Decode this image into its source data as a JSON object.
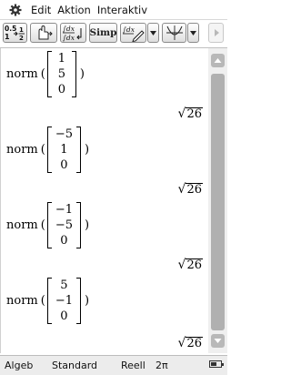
{
  "menubar": {
    "settings_icon": "gear-icon",
    "items": [
      "Edit",
      "Aktion",
      "Interaktiv"
    ]
  },
  "toolbar": {
    "buttons": [
      {
        "icon": "fraction-decimal-toggle-icon",
        "label": "0.5 ↔ 1/2"
      },
      {
        "icon": "drag-hand-icon"
      },
      {
        "icon": "integral-evaluate-icon"
      },
      {
        "label": "Simp"
      },
      {
        "icon": "integral-edit-icon"
      },
      {
        "icon": "dropdown-arrow-icon"
      },
      {
        "icon": "graph-icon"
      },
      {
        "icon": "dropdown-arrow-icon"
      },
      {
        "icon": "toolbar-next-icon"
      }
    ]
  },
  "entries": [
    {
      "function": "norm",
      "open": "(",
      "close": ")",
      "vector": [
        "1",
        "5",
        "0"
      ],
      "result_radicand": "26"
    },
    {
      "function": "norm",
      "open": "(",
      "close": ")",
      "vector": [
        "−5",
        "1",
        "0"
      ],
      "result_radicand": "26"
    },
    {
      "function": "norm",
      "open": "(",
      "close": ")",
      "vector": [
        "−1",
        "−5",
        "0"
      ],
      "result_radicand": "26"
    },
    {
      "function": "norm",
      "open": "(",
      "close": ")",
      "vector": [
        "5",
        "−1",
        "0"
      ],
      "result_radicand": "26"
    }
  ],
  "statusbar": {
    "mode": "Algeb",
    "format": "Standard",
    "number_domain": "Reell",
    "angle": "2π",
    "battery_level": 0.6
  }
}
